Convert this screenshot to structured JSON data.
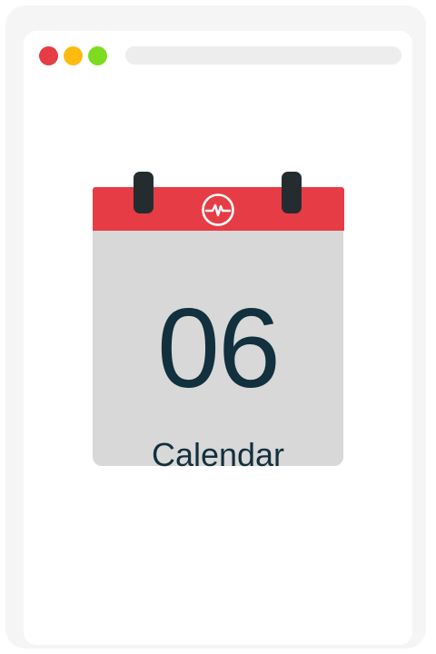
{
  "window": {
    "controls": {
      "close_color": "#e63c45",
      "minimize_color": "#fbbb10",
      "maximize_color": "#7ddc1f"
    },
    "address_bar_color": "#ededee"
  },
  "calendar": {
    "date_number": "06",
    "label": "Calendar",
    "icon": "pulse-icon",
    "header_color": "#e63c45",
    "body_color": "#d8d8d8",
    "text_color": "#12303d"
  }
}
